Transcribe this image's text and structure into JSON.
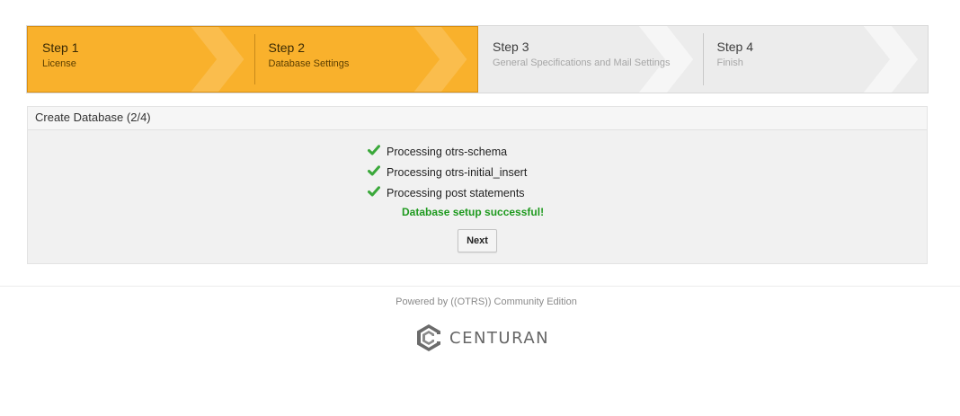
{
  "steps": [
    {
      "title": "Step 1",
      "subtitle": "License",
      "state": "done"
    },
    {
      "title": "Step 2",
      "subtitle": "Database Settings",
      "state": "done"
    },
    {
      "title": "Step 3",
      "subtitle": "General Specifications and Mail Settings",
      "state": "todo"
    },
    {
      "title": "Step 4",
      "subtitle": "Finish",
      "state": "todo"
    }
  ],
  "panel": {
    "title": "Create Database (2/4)",
    "items": [
      {
        "label": "Processing otrs-schema",
        "icon": "checkmark-icon"
      },
      {
        "label": "Processing otrs-initial_insert",
        "icon": "checkmark-icon"
      },
      {
        "label": "Processing post statements",
        "icon": "checkmark-icon"
      }
    ],
    "success_message": "Database setup successful!",
    "next_label": "Next"
  },
  "footer": {
    "powered_by": "Powered by ((OTRS)) Community Edition",
    "logo_text": "CENTURAN",
    "logo_icon": "centuran-logo-icon"
  },
  "colors": {
    "active_step": "#f9b12c",
    "inactive_step": "#ececec",
    "success": "#1f9a1f",
    "check": "#3aa83a"
  }
}
